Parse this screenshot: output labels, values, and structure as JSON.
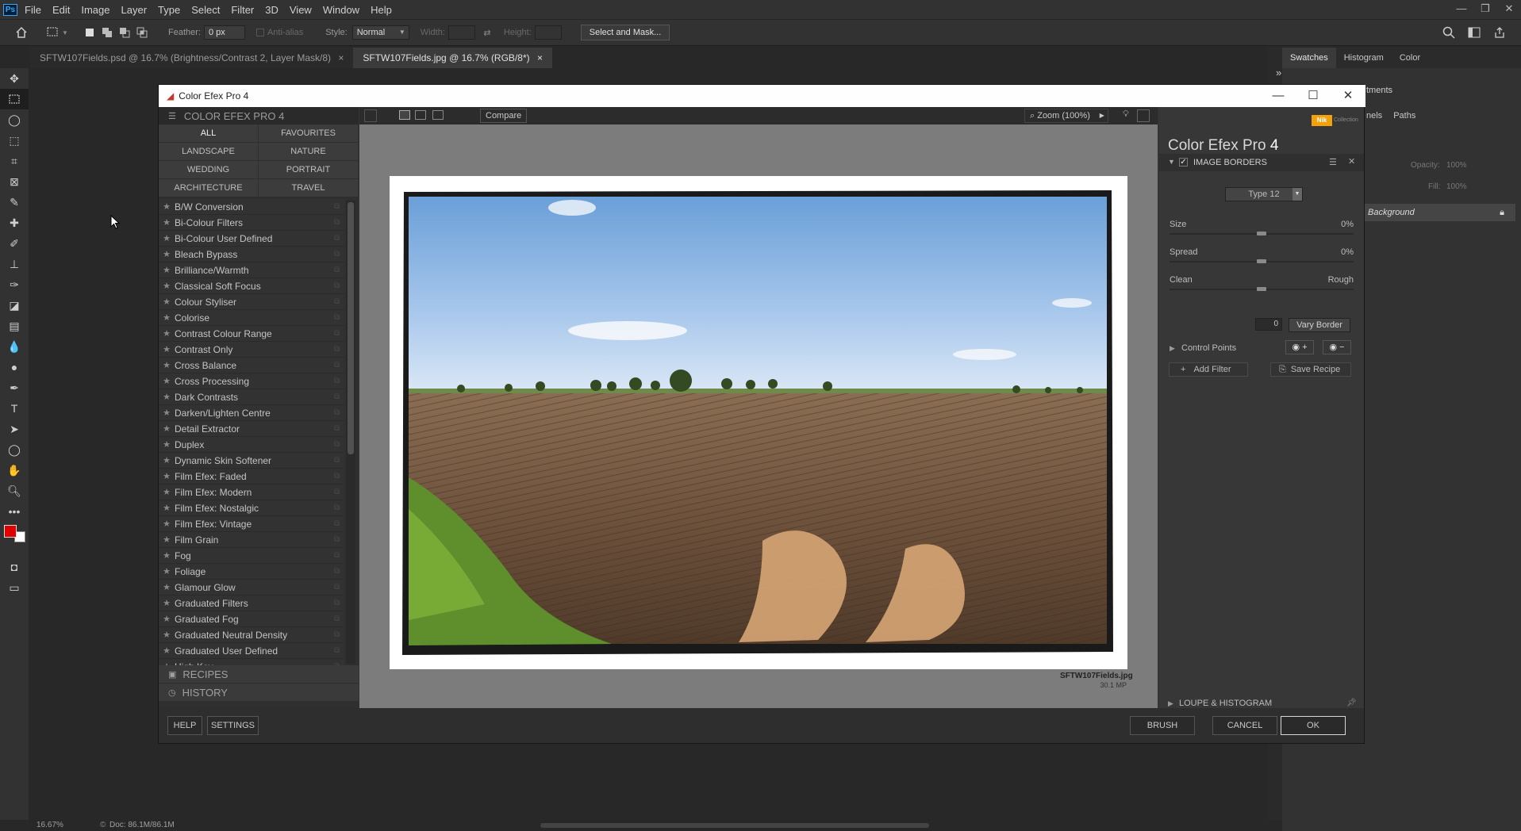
{
  "menubar": {
    "logo": "Ps",
    "items": [
      "File",
      "Edit",
      "Image",
      "Layer",
      "Type",
      "Select",
      "Filter",
      "3D",
      "View",
      "Window",
      "Help"
    ]
  },
  "window_controls": {
    "minimize": "—",
    "restore": "❐",
    "close": "✕"
  },
  "options": {
    "feather_label": "Feather:",
    "feather_value": "0 px",
    "antialias": "Anti-alias",
    "style_label": "Style:",
    "style_value": "Normal",
    "width_label": "Width:",
    "height_label": "Height:",
    "select_mask": "Select and Mask..."
  },
  "tabs": [
    {
      "label": "SFTW107Fields.psd @ 16.7% (Brightness/Contrast 2, Layer Mask/8)",
      "close": "×"
    },
    {
      "label": "SFTW107Fields.jpg @ 16.7% (RGB/8*)",
      "close": "×"
    }
  ],
  "right_panel": {
    "tabs": [
      "Swatches",
      "Histogram",
      "Color"
    ],
    "adjust_label": "tments",
    "tabs2": [
      "nels",
      "Paths"
    ],
    "opacity_label": "Opacity:",
    "opacity_value": "100%",
    "fill_label": "Fill:",
    "fill_value": "100%",
    "layer_name": "Background"
  },
  "dialog": {
    "title": "Color Efex Pro 4",
    "header": "COLOR EFEX PRO 4",
    "categories": [
      "ALL",
      "FAVOURITES",
      "LANDSCAPE",
      "NATURE",
      "WEDDING",
      "PORTRAIT",
      "ARCHITECTURE",
      "TRAVEL"
    ],
    "filters": [
      "B/W Conversion",
      "Bi-Colour Filters",
      "Bi-Colour User Defined",
      "Bleach Bypass",
      "Brilliance/Warmth",
      "Classical Soft Focus",
      "Colour Styliser",
      "Colorise",
      "Contrast Colour Range",
      "Contrast Only",
      "Cross Balance",
      "Cross Processing",
      "Dark Contrasts",
      "Darken/Lighten Centre",
      "Detail Extractor",
      "Duplex",
      "Dynamic Skin Softener",
      "Film Efex: Faded",
      "Film Efex: Modern",
      "Film Efex: Nostalgic",
      "Film Efex: Vintage",
      "Film Grain",
      "Fog",
      "Foliage",
      "Glamour Glow",
      "Graduated Filters",
      "Graduated Fog",
      "Graduated Neutral Density",
      "Graduated User Defined",
      "High Key"
    ],
    "recipes": "RECIPES",
    "history": "HISTORY",
    "compare": "Compare",
    "zoom": "Zoom (100%)",
    "file_name": "SFTW107Fields.jpg",
    "file_size": "30.1 MP",
    "brand": "Color Efex Pro",
    "brand_num": "4",
    "collection": "Collection",
    "filter_panel": {
      "title": "IMAGE BORDERS",
      "type": "Type 12",
      "size_label": "Size",
      "size_value": "0%",
      "spread_label": "Spread",
      "spread_value": "0%",
      "clean_label": "Clean",
      "rough_label": "Rough",
      "vary_value": "0",
      "vary_label": "Vary Border",
      "control_points": "Control Points",
      "add_filter": "Add Filter",
      "save_recipe": "Save Recipe",
      "loupe": "LOUPE & HISTOGRAM"
    },
    "buttons": {
      "help": "HELP",
      "settings": "SETTINGS",
      "brush": "BRUSH",
      "cancel": "CANCEL",
      "ok": "OK"
    }
  },
  "status": {
    "zoom": "16.67%",
    "doc": "Doc: 86.1M/86.1M"
  }
}
